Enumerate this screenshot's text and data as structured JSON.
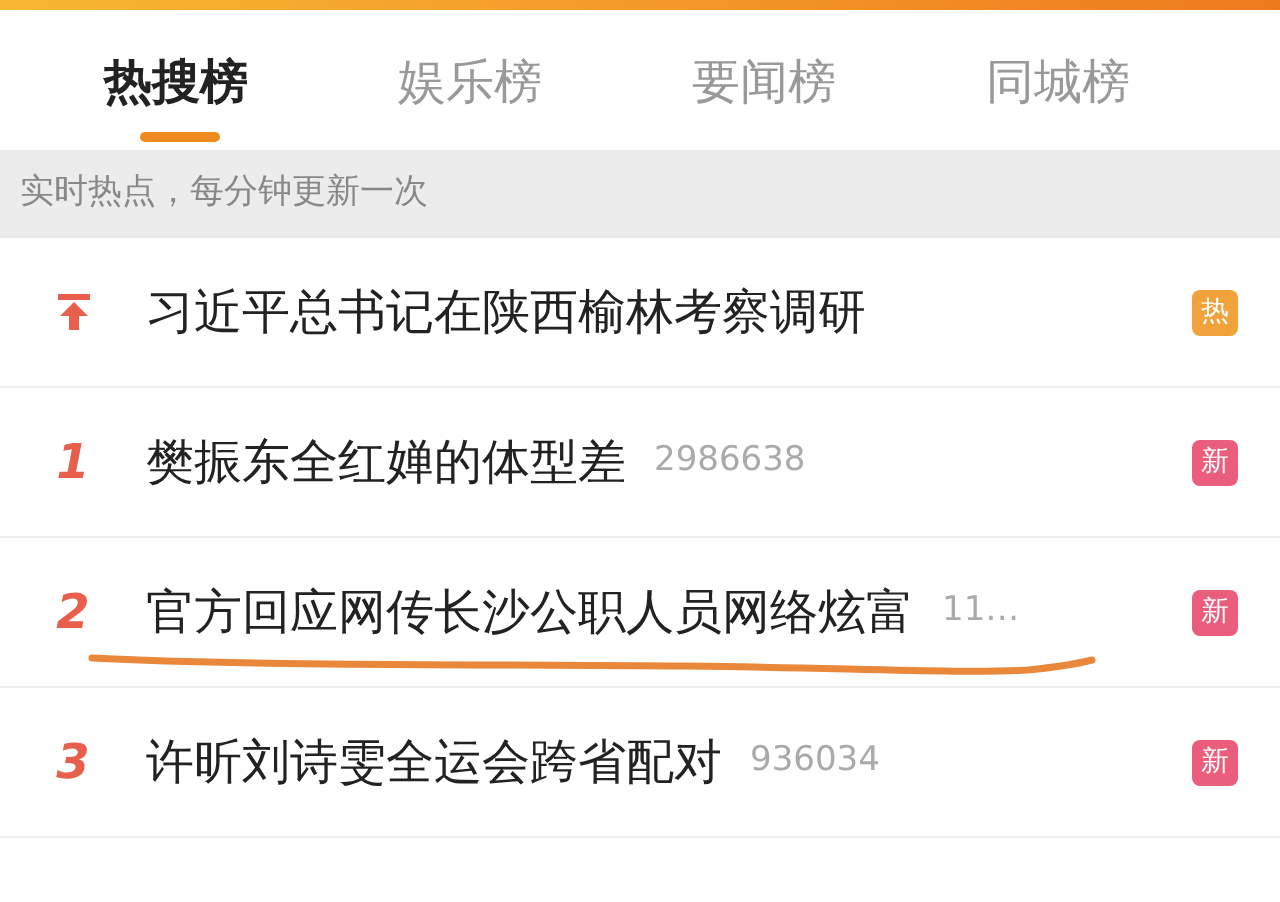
{
  "tabs": [
    {
      "label": "热搜榜",
      "selected": true
    },
    {
      "label": "娱乐榜",
      "selected": false
    },
    {
      "label": "要闻榜",
      "selected": false
    },
    {
      "label": "同城榜",
      "selected": false
    }
  ],
  "subtitle": "实时热点，每分钟更新一次",
  "items": [
    {
      "kind": "pinned",
      "title": "习近平总书记在陕西榆林考察调研",
      "badge": {
        "text": "热",
        "color": "#f2a23a"
      },
      "marked": false
    },
    {
      "kind": "number",
      "rank": "1",
      "title": "樊振东全红婵的体型差",
      "count": "2986638",
      "badge": {
        "text": "新",
        "color": "#ea5d7c"
      },
      "marked": false
    },
    {
      "kind": "number",
      "rank": "2",
      "title": "官方回应网传长沙公职人员网络炫富",
      "count": "11…",
      "badge": {
        "text": "新",
        "color": "#ea5d7c"
      },
      "marked": true
    },
    {
      "kind": "number",
      "rank": "3",
      "title": "许昕刘诗雯全运会跨省配对",
      "count": "936034",
      "badge": {
        "text": "新",
        "color": "#ea5d7c"
      },
      "marked": false
    }
  ]
}
